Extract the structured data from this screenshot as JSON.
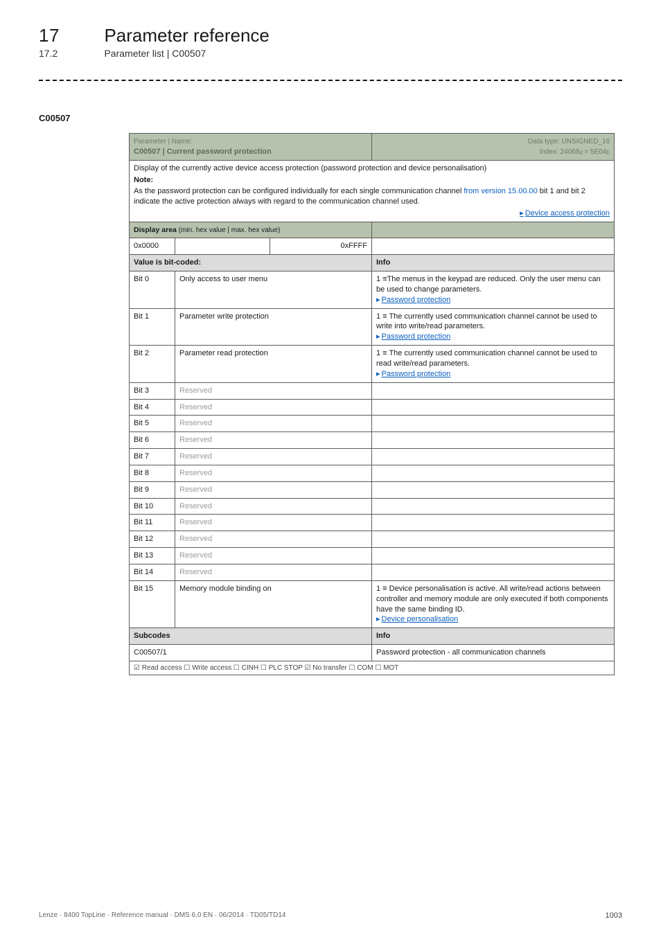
{
  "chapter": {
    "num": "17",
    "title": "Parameter reference"
  },
  "section": {
    "num": "17.2",
    "title": "Parameter list | C00507"
  },
  "param_code": "C00507",
  "header": {
    "label": "Parameter | Name:",
    "name": "C00507 | Current password protection",
    "dtype": "Data type: UNSIGNED_16",
    "index_pre": "Index: 24068",
    "index_sub1": "d",
    "index_mid": " = 5E04",
    "index_sub2": "h"
  },
  "note": {
    "line1": "Display of the currently active device access protection (password protection and device personalisation)",
    "label": "Note:",
    "line2a": "As the password protection can be configured individually for each single communication channel ",
    "line2_link1": "from version 15.00.00",
    "line2b": " bit 1 and bit 2 indicate the active protection always with regard to the communication channel used.",
    "arrowlink": "Device access protection"
  },
  "display_area": {
    "label": "Display area ",
    "sm": "(min. hex value | max. hex value)"
  },
  "hexrow": {
    "left": "0x0000",
    "right": "0xFFFF"
  },
  "bitcoded_label": "Value is bit-coded:",
  "info_label": "Info",
  "bits": [
    {
      "num": "Bit 0",
      "label": "Only access to user menu",
      "info_lines": [
        "1 ≡The menus in the keypad are reduced. Only the user menu can be used to change parameters."
      ],
      "info_link": "Password protection"
    },
    {
      "num": "Bit 1",
      "label": "Parameter write protection",
      "info_lines": [
        "1 ≡ The currently used communication channel cannot be used to write into write/read parameters."
      ],
      "info_link": "Password protection"
    },
    {
      "num": "Bit 2",
      "label": "Parameter read protection",
      "info_lines": [
        "1 ≡ The currently used communication channel cannot be used to read write/read parameters."
      ],
      "info_link": "Password protection"
    },
    {
      "num": "Bit 3",
      "label": "Reserved",
      "reserved": true
    },
    {
      "num": "Bit 4",
      "label": "Reserved",
      "reserved": true
    },
    {
      "num": "Bit 5",
      "label": "Reserved",
      "reserved": true
    },
    {
      "num": "Bit 6",
      "label": "Reserved",
      "reserved": true
    },
    {
      "num": "Bit 7",
      "label": "Reserved",
      "reserved": true
    },
    {
      "num": "Bit 8",
      "label": "Reserved",
      "reserved": true
    },
    {
      "num": "Bit 9",
      "label": "Reserved",
      "reserved": true
    },
    {
      "num": "Bit 10",
      "label": "Reserved",
      "reserved": true
    },
    {
      "num": "Bit 11",
      "label": "Reserved",
      "reserved": true
    },
    {
      "num": "Bit 12",
      "label": "Reserved",
      "reserved": true
    },
    {
      "num": "Bit 13",
      "label": "Reserved",
      "reserved": true
    },
    {
      "num": "Bit 14",
      "label": "Reserved",
      "reserved": true
    },
    {
      "num": "Bit 15",
      "label": "Memory module binding on",
      "info_lines": [
        "1 ≡ Device personalisation is active. All write/read actions between controller and memory module are only executed if both components have the same binding ID."
      ],
      "info_link": "Device personalisation"
    }
  ],
  "subcodes_label": "Subcodes",
  "subcode_row": {
    "code": "C00507/1",
    "desc": "Password protection - all communication channels"
  },
  "footrow": "☑ Read access   ☐ Write access   ☐ CINH   ☐ PLC STOP   ☑ No transfer   ☐ COM   ☐ MOT",
  "footer": {
    "left": "Lenze · 8400 TopLine · Reference manual · DMS 6.0 EN · 06/2014 · TD05/TD14",
    "page": "1003"
  }
}
